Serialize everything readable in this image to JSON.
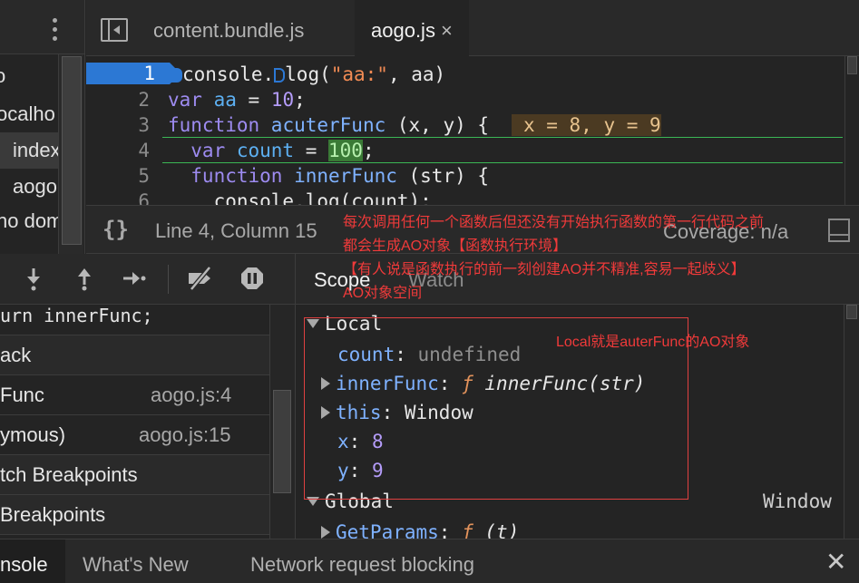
{
  "navigator": {
    "rows": [
      "o",
      "ocalho",
      "index",
      "aogo",
      "no dom"
    ]
  },
  "tabs": [
    {
      "label": "content.bundle.js",
      "active": false
    },
    {
      "label": "aogo.js",
      "active": true,
      "close": "×"
    }
  ],
  "editor": {
    "line_numbers": [
      "1",
      "2",
      "3",
      "4",
      "5",
      "6"
    ],
    "breakpoint_line": "1",
    "lines": {
      "l1": {
        "a": "console.",
        "b": "log(",
        "c": "\"aa:\"",
        "d": ", aa)"
      },
      "l2": {
        "kw": "var",
        "name": " aa",
        "eq": " = ",
        "val": "10",
        "end": ";"
      },
      "l3": {
        "kw": "function",
        "name": " acuterFunc",
        "args": " (x, y) {",
        "inline": " x = 8, y = 9"
      },
      "l4": {
        "kw": "  var",
        "name": " count",
        "eq": " = ",
        "val": "100",
        "end": ";"
      },
      "l5": {
        "kw": "  function",
        "name": " innerFunc",
        "args": " (str) {"
      },
      "l6": {
        "text": "    console.log(count);"
      }
    }
  },
  "status": {
    "braces": "{}",
    "position": "Line 4, Column 15",
    "coverage": "Coverage: n/a"
  },
  "left_panes": {
    "rows": [
      {
        "name": "urn innerFunc;",
        "loc": "",
        "mono": true
      },
      {
        "name": "ack",
        "loc": ""
      },
      {
        "name": "Func",
        "loc": "aogo.js:4"
      },
      {
        "name": "ymous)",
        "loc": "aogo.js:15"
      },
      {
        "name": "tch Breakpoints",
        "loc": ""
      },
      {
        "name": "Breakpoints",
        "loc": ""
      }
    ]
  },
  "scope": {
    "tabs": [
      "Scope",
      "Watch"
    ],
    "local_label": "Local",
    "global_label": "Global",
    "global_value": "Window",
    "count": {
      "key": "count",
      "value": "undefined"
    },
    "inner": {
      "key": "innerFunc",
      "sym": "ƒ",
      "sig": "innerFunc(str)"
    },
    "this": {
      "key": "this",
      "value": "Window"
    },
    "x": {
      "key": "x",
      "value": "8"
    },
    "y": {
      "key": "y",
      "value": "9"
    },
    "getparams": {
      "key": "GetParams",
      "sym": "ƒ",
      "sig": "(t)"
    }
  },
  "drawer": {
    "tabs": [
      "nsole",
      "What's New",
      "Network request blocking"
    ],
    "close": "✕"
  },
  "annotations": {
    "line1": "每次调用任何一个函数后但还没有开始执行函数的第一行代码之前",
    "line2": "都会生成AO对象【函数执行环境】",
    "line3": "【有人说是函数执行的前一刻创建AO并不精准,容易一起歧义】",
    "line4": "AO对象空间",
    "local_note": "Local就是auterFunc的AO对象"
  },
  "colors": {
    "accent": "#2c78d4",
    "annotation": "#f03a3a",
    "paused_line": "#3bb655"
  }
}
